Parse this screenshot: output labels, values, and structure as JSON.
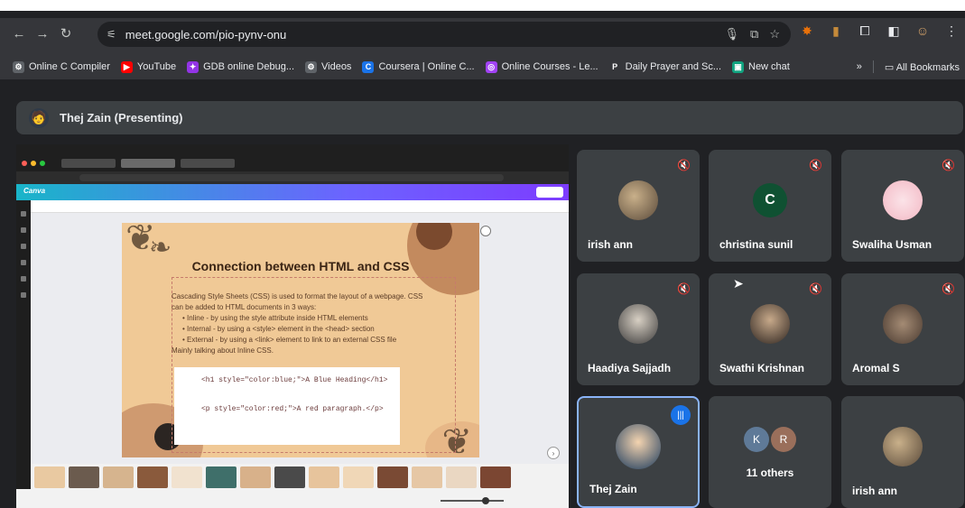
{
  "browser": {
    "url": "meet.google.com/pio-pynv-onu",
    "bookmarks": [
      {
        "label": "Online C Compiler",
        "color": "#5f6368",
        "glyph": "⚙"
      },
      {
        "label": "YouTube",
        "color": "#ff0000",
        "glyph": "▶"
      },
      {
        "label": "GDB online Debug...",
        "color": "#9334e6",
        "glyph": "✦"
      },
      {
        "label": "Videos",
        "color": "#5f6368",
        "glyph": "⚙"
      },
      {
        "label": "Coursera | Online C...",
        "color": "#1a73e8",
        "glyph": "C"
      },
      {
        "label": "Online Courses - Le...",
        "color": "#a142f4",
        "glyph": "◎"
      },
      {
        "label": "Daily Prayer and Sc...",
        "color": "#35363a",
        "glyph": "P"
      },
      {
        "label": "New chat",
        "color": "#10a37f",
        "glyph": "▣"
      }
    ],
    "more_bookmarks": "»",
    "all_bookmarks": "All Bookmarks"
  },
  "meet": {
    "presenter_label": "Thej Zain (Presenting)",
    "slide": {
      "title": "Connection between HTML and CSS",
      "intro": "Cascading Style Sheets (CSS) is used to format the layout of a webpage. CSS can be added to HTML documents in 3 ways:",
      "bullets": [
        "Inline - by using the style attribute inside HTML elements",
        "Internal - by using a <style> element in the <head> section",
        "External - by using a <link> element to link to an external CSS file"
      ],
      "note": "Mainly talking about Inline CSS.",
      "code1": "<h1 style=\"color:blue;\">A Blue Heading</h1>",
      "code2": "<p style=\"color:red;\">A red paragraph.</p>"
    },
    "tiles": [
      {
        "name": "irish ann"
      },
      {
        "name": "christina sunil",
        "letter": "C"
      },
      {
        "name": "Swaliha Usman"
      },
      {
        "name": "Haadiya Sajjadh"
      },
      {
        "name": "Swathi Krishnan"
      },
      {
        "name": "Aromal S"
      },
      {
        "name": "Thej Zain"
      },
      {
        "name": "11 others",
        "initials": [
          "K",
          "R"
        ]
      },
      {
        "name": "irish ann"
      }
    ]
  }
}
